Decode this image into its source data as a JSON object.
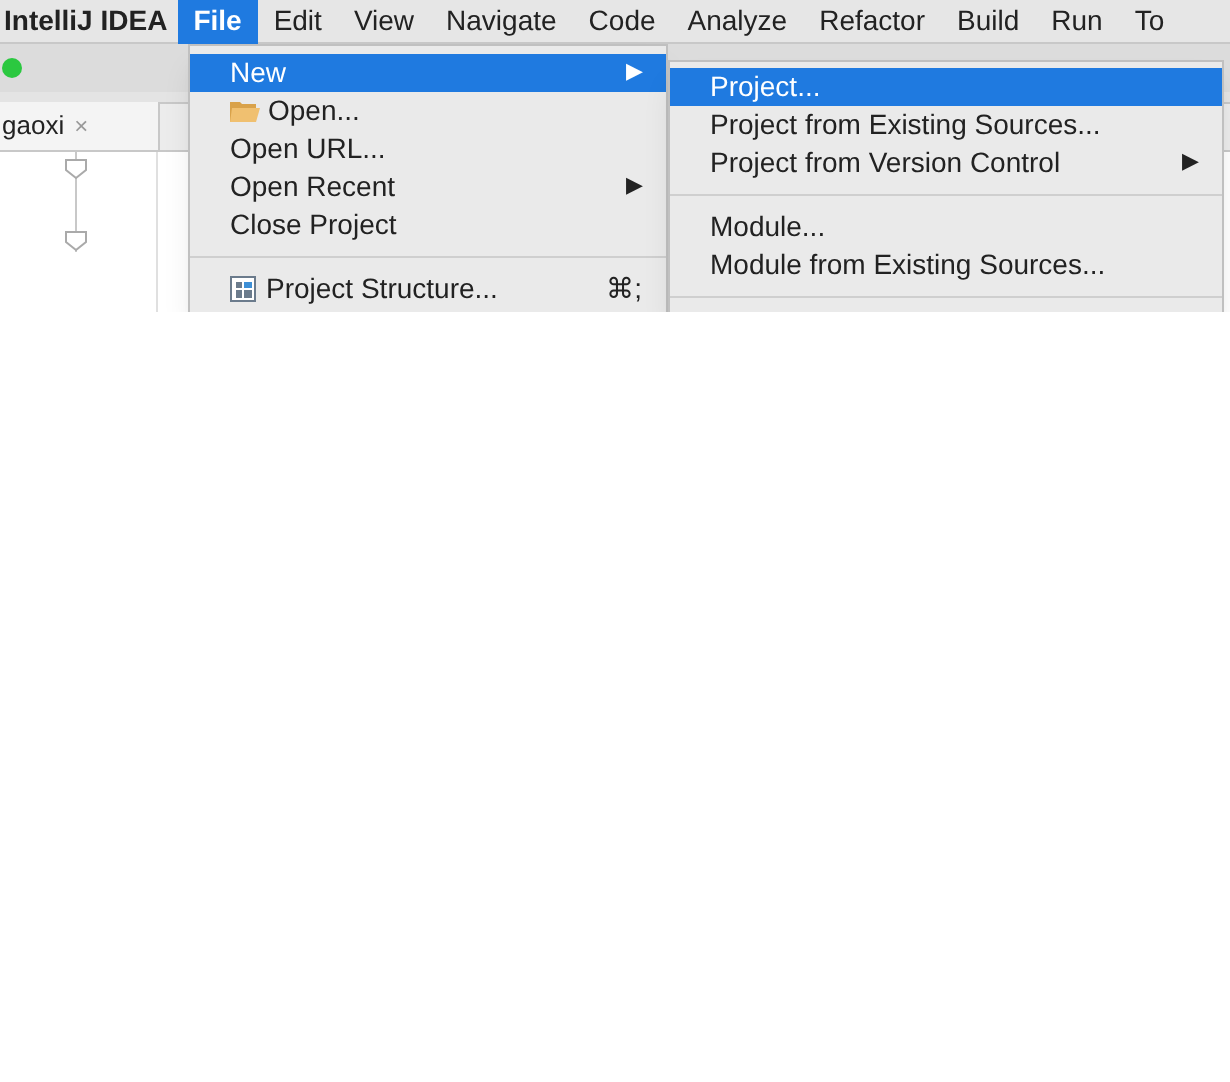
{
  "menubar": {
    "app_name": "IntelliJ IDEA",
    "menus": [
      {
        "label": "File",
        "selected": true
      },
      {
        "label": "Edit",
        "selected": false
      },
      {
        "label": "View",
        "selected": false
      },
      {
        "label": "Navigate",
        "selected": false
      },
      {
        "label": "Code",
        "selected": false
      },
      {
        "label": "Analyze",
        "selected": false
      },
      {
        "label": "Refactor",
        "selected": false
      },
      {
        "label": "Build",
        "selected": false
      },
      {
        "label": "Run",
        "selected": false
      },
      {
        "label": "To",
        "selected": false
      }
    ]
  },
  "editor": {
    "tab": {
      "label": "gaoxi",
      "close": "×"
    }
  },
  "file_menu": {
    "items": [
      {
        "kind": "item",
        "label": "New",
        "arrow": "▶",
        "selected": true
      },
      {
        "kind": "folder_item",
        "label": "Open...",
        "selected": false
      },
      {
        "kind": "item",
        "label": "Open URL...",
        "selected": false
      },
      {
        "kind": "item",
        "label": "Open Recent",
        "arrow": "▶",
        "selected": false
      },
      {
        "kind": "item",
        "label": "Close Project",
        "selected": false
      },
      {
        "kind": "separator"
      },
      {
        "kind": "structure_item",
        "label": "Project Structure...",
        "shortcut": "⌘;",
        "selected": false
      }
    ]
  },
  "new_submenu": {
    "items": [
      {
        "kind": "item",
        "label": "Project...",
        "selected": true
      },
      {
        "kind": "item",
        "label": "Project from Existing Sources...",
        "selected": false
      },
      {
        "kind": "item",
        "label": "Project from Version Control",
        "arrow": "▶",
        "selected": false
      },
      {
        "kind": "separator"
      },
      {
        "kind": "item",
        "label": "Module...",
        "selected": false
      },
      {
        "kind": "item",
        "label": "Module from Existing Sources...",
        "selected": false
      },
      {
        "kind": "separator"
      }
    ]
  }
}
